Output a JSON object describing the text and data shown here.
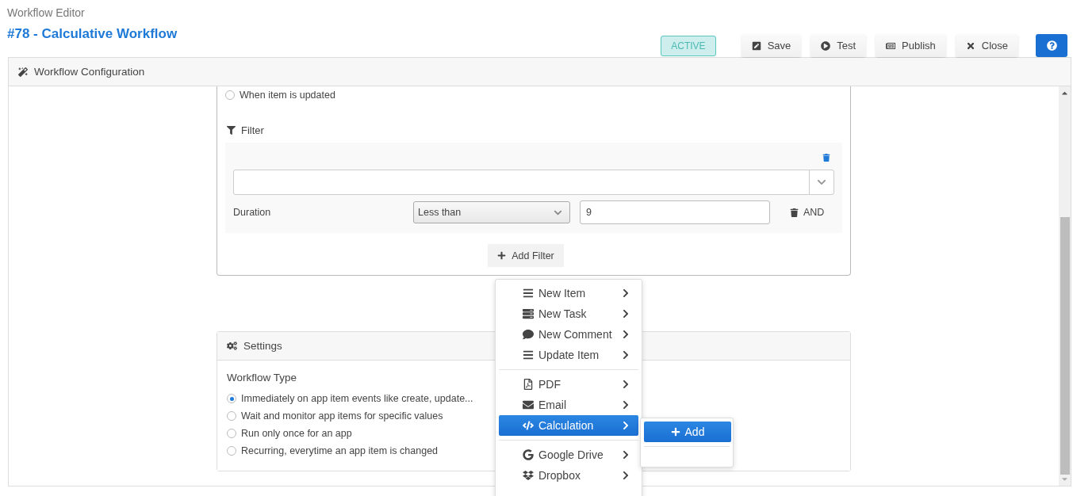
{
  "header": {
    "subtitle": "Workflow Editor",
    "title": "#78 - Calculative Workflow"
  },
  "toolbar": {
    "status": "ACTIVE",
    "buttons": [
      {
        "label": "Save",
        "kind": "edit"
      },
      {
        "label": "Test",
        "kind": "play"
      },
      {
        "label": "Publish",
        "kind": "newspaper"
      },
      {
        "label": "Close",
        "kind": "close"
      }
    ]
  },
  "panel": {
    "title": "Workflow Configuration"
  },
  "trigger": {
    "options": [
      {
        "label": "When item is updated",
        "selected": false
      }
    ]
  },
  "filter": {
    "title": "Filter",
    "conditions": [
      {
        "field": "Duration",
        "operator": "Less than",
        "value": "9",
        "connector": "AND"
      }
    ],
    "add_button": "Add Filter"
  },
  "settings": {
    "title": "Settings",
    "type_label": "Workflow Type",
    "options": [
      {
        "label": "Immediately on app item events like create, update...",
        "selected": true
      },
      {
        "label": "Wait and monitor app items for specific values",
        "selected": false
      },
      {
        "label": "Run only once for an app",
        "selected": false
      },
      {
        "label": "Recurring, everytime an app item is changed",
        "selected": false
      }
    ]
  },
  "action_menu": {
    "groups": [
      [
        {
          "label": "New Item",
          "kind": "bars",
          "selected": false
        },
        {
          "label": "New Task",
          "kind": "tasks",
          "selected": false
        },
        {
          "label": "New Comment",
          "kind": "comment",
          "selected": false
        },
        {
          "label": "Update Item",
          "kind": "bars",
          "selected": false
        }
      ],
      [
        {
          "label": "PDF",
          "kind": "pdf",
          "selected": false
        },
        {
          "label": "Email",
          "kind": "envelope",
          "selected": false
        },
        {
          "label": "Calculation",
          "kind": "code",
          "selected": true
        }
      ],
      [
        {
          "label": "Google Drive",
          "kind": "google",
          "selected": false
        },
        {
          "label": "Dropbox",
          "kind": "dropbox",
          "selected": false
        }
      ]
    ]
  },
  "submenu": {
    "items": [
      {
        "label": "Add"
      }
    ]
  }
}
